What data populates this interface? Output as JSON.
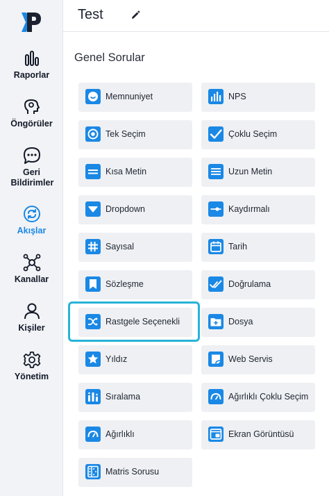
{
  "header": {
    "title": "Test"
  },
  "sidebar": {
    "items": [
      {
        "label": "Raporlar"
      },
      {
        "label": "Öngörüler"
      },
      {
        "label": "Geri Bildirimler"
      },
      {
        "label": "Akışlar"
      },
      {
        "label": "Kanallar"
      },
      {
        "label": "Kişiler"
      },
      {
        "label": "Yönetim"
      }
    ],
    "active_item": "Akışlar"
  },
  "main": {
    "section_title": "Genel Sorular",
    "questions_left": [
      {
        "label": "Memnuniyet",
        "icon": "smiley-icon"
      },
      {
        "label": "Tek Seçim",
        "icon": "radio-icon"
      },
      {
        "label": "Kısa Metin",
        "icon": "short-text-icon"
      },
      {
        "label": "Dropdown",
        "icon": "dropdown-icon"
      },
      {
        "label": "Sayısal",
        "icon": "hashtag-icon"
      },
      {
        "label": "Sözleşme",
        "icon": "bookmark-icon"
      },
      {
        "label": "Rastgele Seçenekli",
        "icon": "shuffle-icon"
      },
      {
        "label": "Yıldız",
        "icon": "star-icon"
      },
      {
        "label": "Sıralama",
        "icon": "ranking-icon"
      },
      {
        "label": "Ağırlıklı",
        "icon": "gauge-icon"
      },
      {
        "label": "Matris Sorusu",
        "icon": "matrix-icon"
      }
    ],
    "questions_right": [
      {
        "label": "NPS",
        "icon": "bar-chart-icon"
      },
      {
        "label": "Çoklu Seçim",
        "icon": "checkmark-icon"
      },
      {
        "label": "Uzun Metin",
        "icon": "long-text-icon"
      },
      {
        "label": "Kaydırmalı",
        "icon": "slider-icon"
      },
      {
        "label": "Tarih",
        "icon": "calendar-icon"
      },
      {
        "label": "Doğrulama",
        "icon": "double-check-icon"
      },
      {
        "label": "Dosya",
        "icon": "folder-plus-icon"
      },
      {
        "label": "Web Servis",
        "icon": "cloud-icon"
      },
      {
        "label": "Ağırlıklı Çoklu Seçim",
        "icon": "gauge-icon"
      },
      {
        "label": "Ekran Görüntüsü",
        "icon": "screenshot-icon"
      }
    ],
    "highlighted_question": "Rastgele Seçenekli"
  },
  "colors": {
    "accent": "#1a88e5",
    "highlight": "#27b3d8",
    "card_bg": "#eef0f3",
    "sidebar_bg": "#f2f3f6"
  }
}
